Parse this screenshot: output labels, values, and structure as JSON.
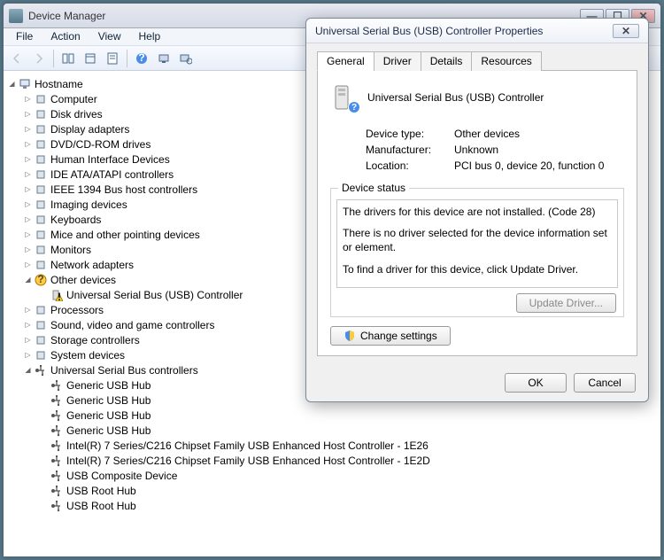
{
  "window": {
    "title": "Device Manager",
    "minimize": "—",
    "maximize": "☐",
    "close": "✕"
  },
  "menubar": [
    "File",
    "Action",
    "View",
    "Help"
  ],
  "toolbar_icons": [
    "back",
    "forward",
    "show-hide",
    "brackets",
    "page",
    "help",
    "scan",
    "screen-gear"
  ],
  "tree": {
    "root": "Hostname",
    "categories": [
      "Computer",
      "Disk drives",
      "Display adapters",
      "DVD/CD-ROM drives",
      "Human Interface Devices",
      "IDE ATA/ATAPI controllers",
      "IEEE 1394 Bus host controllers",
      "Imaging devices",
      "Keyboards",
      "Mice and other pointing devices",
      "Monitors",
      "Network adapters"
    ],
    "other_devices": {
      "label": "Other devices",
      "child": "Universal Serial Bus (USB) Controller"
    },
    "categories2": [
      "Processors",
      "Sound, video and game controllers",
      "Storage controllers",
      "System devices"
    ],
    "usb": {
      "label": "Universal Serial Bus controllers",
      "children": [
        "Generic USB Hub",
        "Generic USB Hub",
        "Generic USB Hub",
        "Generic USB Hub",
        "Intel(R) 7 Series/C216 Chipset Family USB Enhanced Host Controller - 1E26",
        "Intel(R) 7 Series/C216 Chipset Family USB Enhanced Host Controller - 1E2D",
        "USB Composite Device",
        "USB Root Hub",
        "USB Root Hub"
      ]
    }
  },
  "dialog": {
    "title": "Universal Serial Bus (USB) Controller Properties",
    "close": "✕",
    "tabs": [
      "General",
      "Driver",
      "Details",
      "Resources"
    ],
    "active_tab": 0,
    "device_name": "Universal Serial Bus (USB) Controller",
    "info": {
      "type_label": "Device type:",
      "type_value": "Other devices",
      "mfr_label": "Manufacturer:",
      "mfr_value": "Unknown",
      "loc_label": "Location:",
      "loc_value": "PCI bus 0, device 20, function 0"
    },
    "status_label": "Device status",
    "status_lines": {
      "l1": "The drivers for this device are not installed. (Code 28)",
      "l2": "There is no driver selected for the device information set or element.",
      "l3": "To find a driver for this device, click Update Driver."
    },
    "update_btn": "Update Driver...",
    "change_btn": "Change settings",
    "ok": "OK",
    "cancel": "Cancel"
  }
}
